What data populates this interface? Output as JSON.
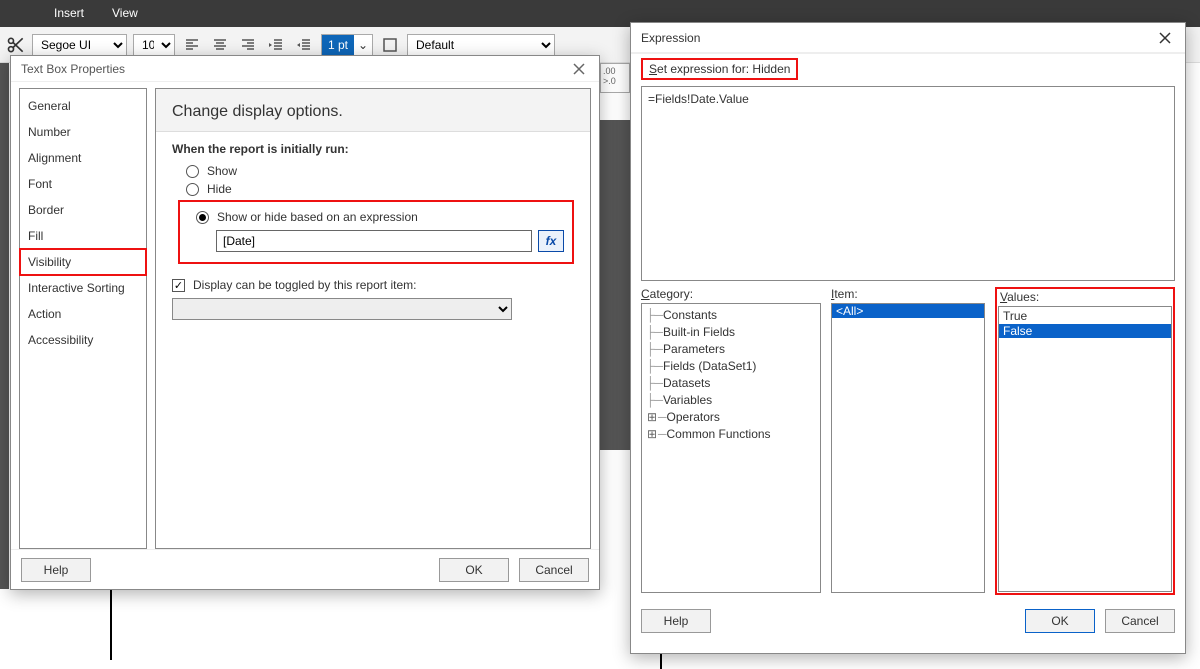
{
  "ribbon": {
    "menu": [
      "Insert",
      "View"
    ]
  },
  "toolbar": {
    "font_name": "Segoe UI",
    "font_size": "10",
    "line_width_label": "1 pt",
    "style_combo": "Default"
  },
  "textbox_dialog": {
    "title": "Text Box Properties",
    "nav": [
      "General",
      "Number",
      "Alignment",
      "Font",
      "Border",
      "Fill",
      "Visibility",
      "Interactive Sorting",
      "Action",
      "Accessibility"
    ],
    "nav_selected_index": 6,
    "heading": "Change display options.",
    "group_label": "When the report is initially run:",
    "radio_show": "Show",
    "radio_hide": "Hide",
    "radio_expr": "Show or hide based on an expression",
    "expr_value": "[Date]",
    "fx_label": "fx",
    "display_toggle_label": "Display can be toggled by this report item:",
    "help_label": "Help",
    "ok_label": "OK",
    "cancel_label": "Cancel"
  },
  "expression_dialog": {
    "title": "Expression",
    "set_expr_prefix": "Set expression for: ",
    "set_expr_target": "Hidden",
    "editor_value": "=Fields!Date.Value",
    "category_label": "Category:",
    "item_label": "Item:",
    "values_label": "Values:",
    "categories": [
      "Constants",
      "Built-in Fields",
      "Parameters",
      "Fields (DataSet1)",
      "Datasets",
      "Variables",
      "Operators",
      "Common Functions"
    ],
    "categories_expandable": [
      false,
      false,
      false,
      false,
      false,
      false,
      true,
      true
    ],
    "item_list": [
      "<All>"
    ],
    "item_selected_index": 0,
    "values_list": [
      "True",
      "False"
    ],
    "values_selected_index": 1,
    "help_label": "Help",
    "ok_label": "OK",
    "cancel_label": "Cancel"
  },
  "ruler_frag": ".00\n>.0"
}
